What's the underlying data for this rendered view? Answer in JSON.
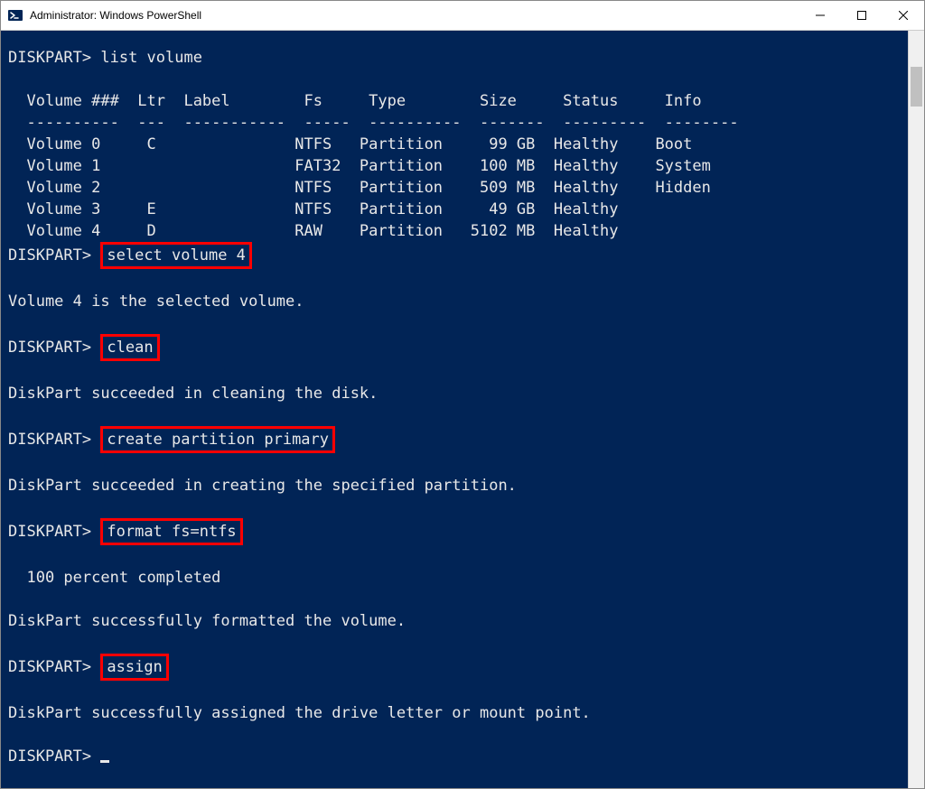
{
  "window": {
    "title": "Administrator: Windows PowerShell"
  },
  "prompt": "DISKPART>",
  "cmd_list_volume": "list volume",
  "table": {
    "headers": {
      "num": "Volume ###",
      "ltr": "Ltr",
      "label": "Label",
      "fs": "Fs",
      "type": "Type",
      "size": "Size",
      "status": "Status",
      "info": "Info"
    },
    "rows": [
      {
        "num": "Volume 0",
        "ltr": "C",
        "label": "",
        "fs": "NTFS",
        "type": "Partition",
        "size": "99 GB",
        "status": "Healthy",
        "info": "Boot"
      },
      {
        "num": "Volume 1",
        "ltr": "",
        "label": "",
        "fs": "FAT32",
        "type": "Partition",
        "size": "100 MB",
        "status": "Healthy",
        "info": "System"
      },
      {
        "num": "Volume 2",
        "ltr": "",
        "label": "",
        "fs": "NTFS",
        "type": "Partition",
        "size": "509 MB",
        "status": "Healthy",
        "info": "Hidden"
      },
      {
        "num": "Volume 3",
        "ltr": "E",
        "label": "",
        "fs": "NTFS",
        "type": "Partition",
        "size": "49 GB",
        "status": "Healthy",
        "info": ""
      },
      {
        "num": "Volume 4",
        "ltr": "D",
        "label": "",
        "fs": "RAW",
        "type": "Partition",
        "size": "5102 MB",
        "status": "Healthy",
        "info": ""
      }
    ]
  },
  "highlighted_commands": {
    "select_volume": "select volume 4",
    "clean": "clean",
    "create_partition": "create partition primary",
    "format": "format fs=ntfs",
    "assign": "assign"
  },
  "messages": {
    "selected": "Volume 4 is the selected volume.",
    "clean_ok": "DiskPart succeeded in cleaning the disk.",
    "create_ok": "DiskPart succeeded in creating the specified partition.",
    "progress": "  100 percent completed",
    "format_ok": "DiskPart successfully formatted the volume.",
    "assign_ok": "DiskPart successfully assigned the drive letter or mount point."
  }
}
